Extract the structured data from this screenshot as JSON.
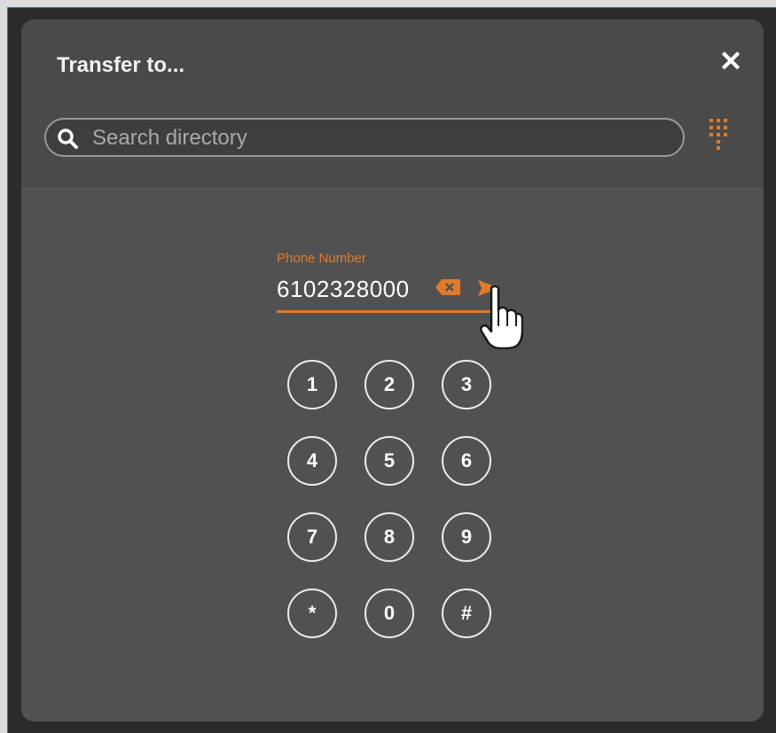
{
  "dialog": {
    "title": "Transfer to...",
    "close_label": "✕"
  },
  "search": {
    "placeholder": "Search directory",
    "value": ""
  },
  "phone": {
    "label": "Phone Number",
    "value": "6102328000"
  },
  "keypad": {
    "keys": [
      "1",
      "2",
      "3",
      "4",
      "5",
      "6",
      "7",
      "8",
      "9",
      "*",
      "0",
      "#"
    ]
  },
  "colors": {
    "accent": "#e07a2a",
    "dialog_bg": "#515151",
    "header_bg": "#4a4a4a",
    "text": "#ffffff"
  },
  "icons": {
    "search": "search-icon",
    "keypad_toggle": "keypad-icon",
    "backspace": "backspace-icon",
    "send": "send-arrow-icon",
    "close": "close-icon"
  }
}
